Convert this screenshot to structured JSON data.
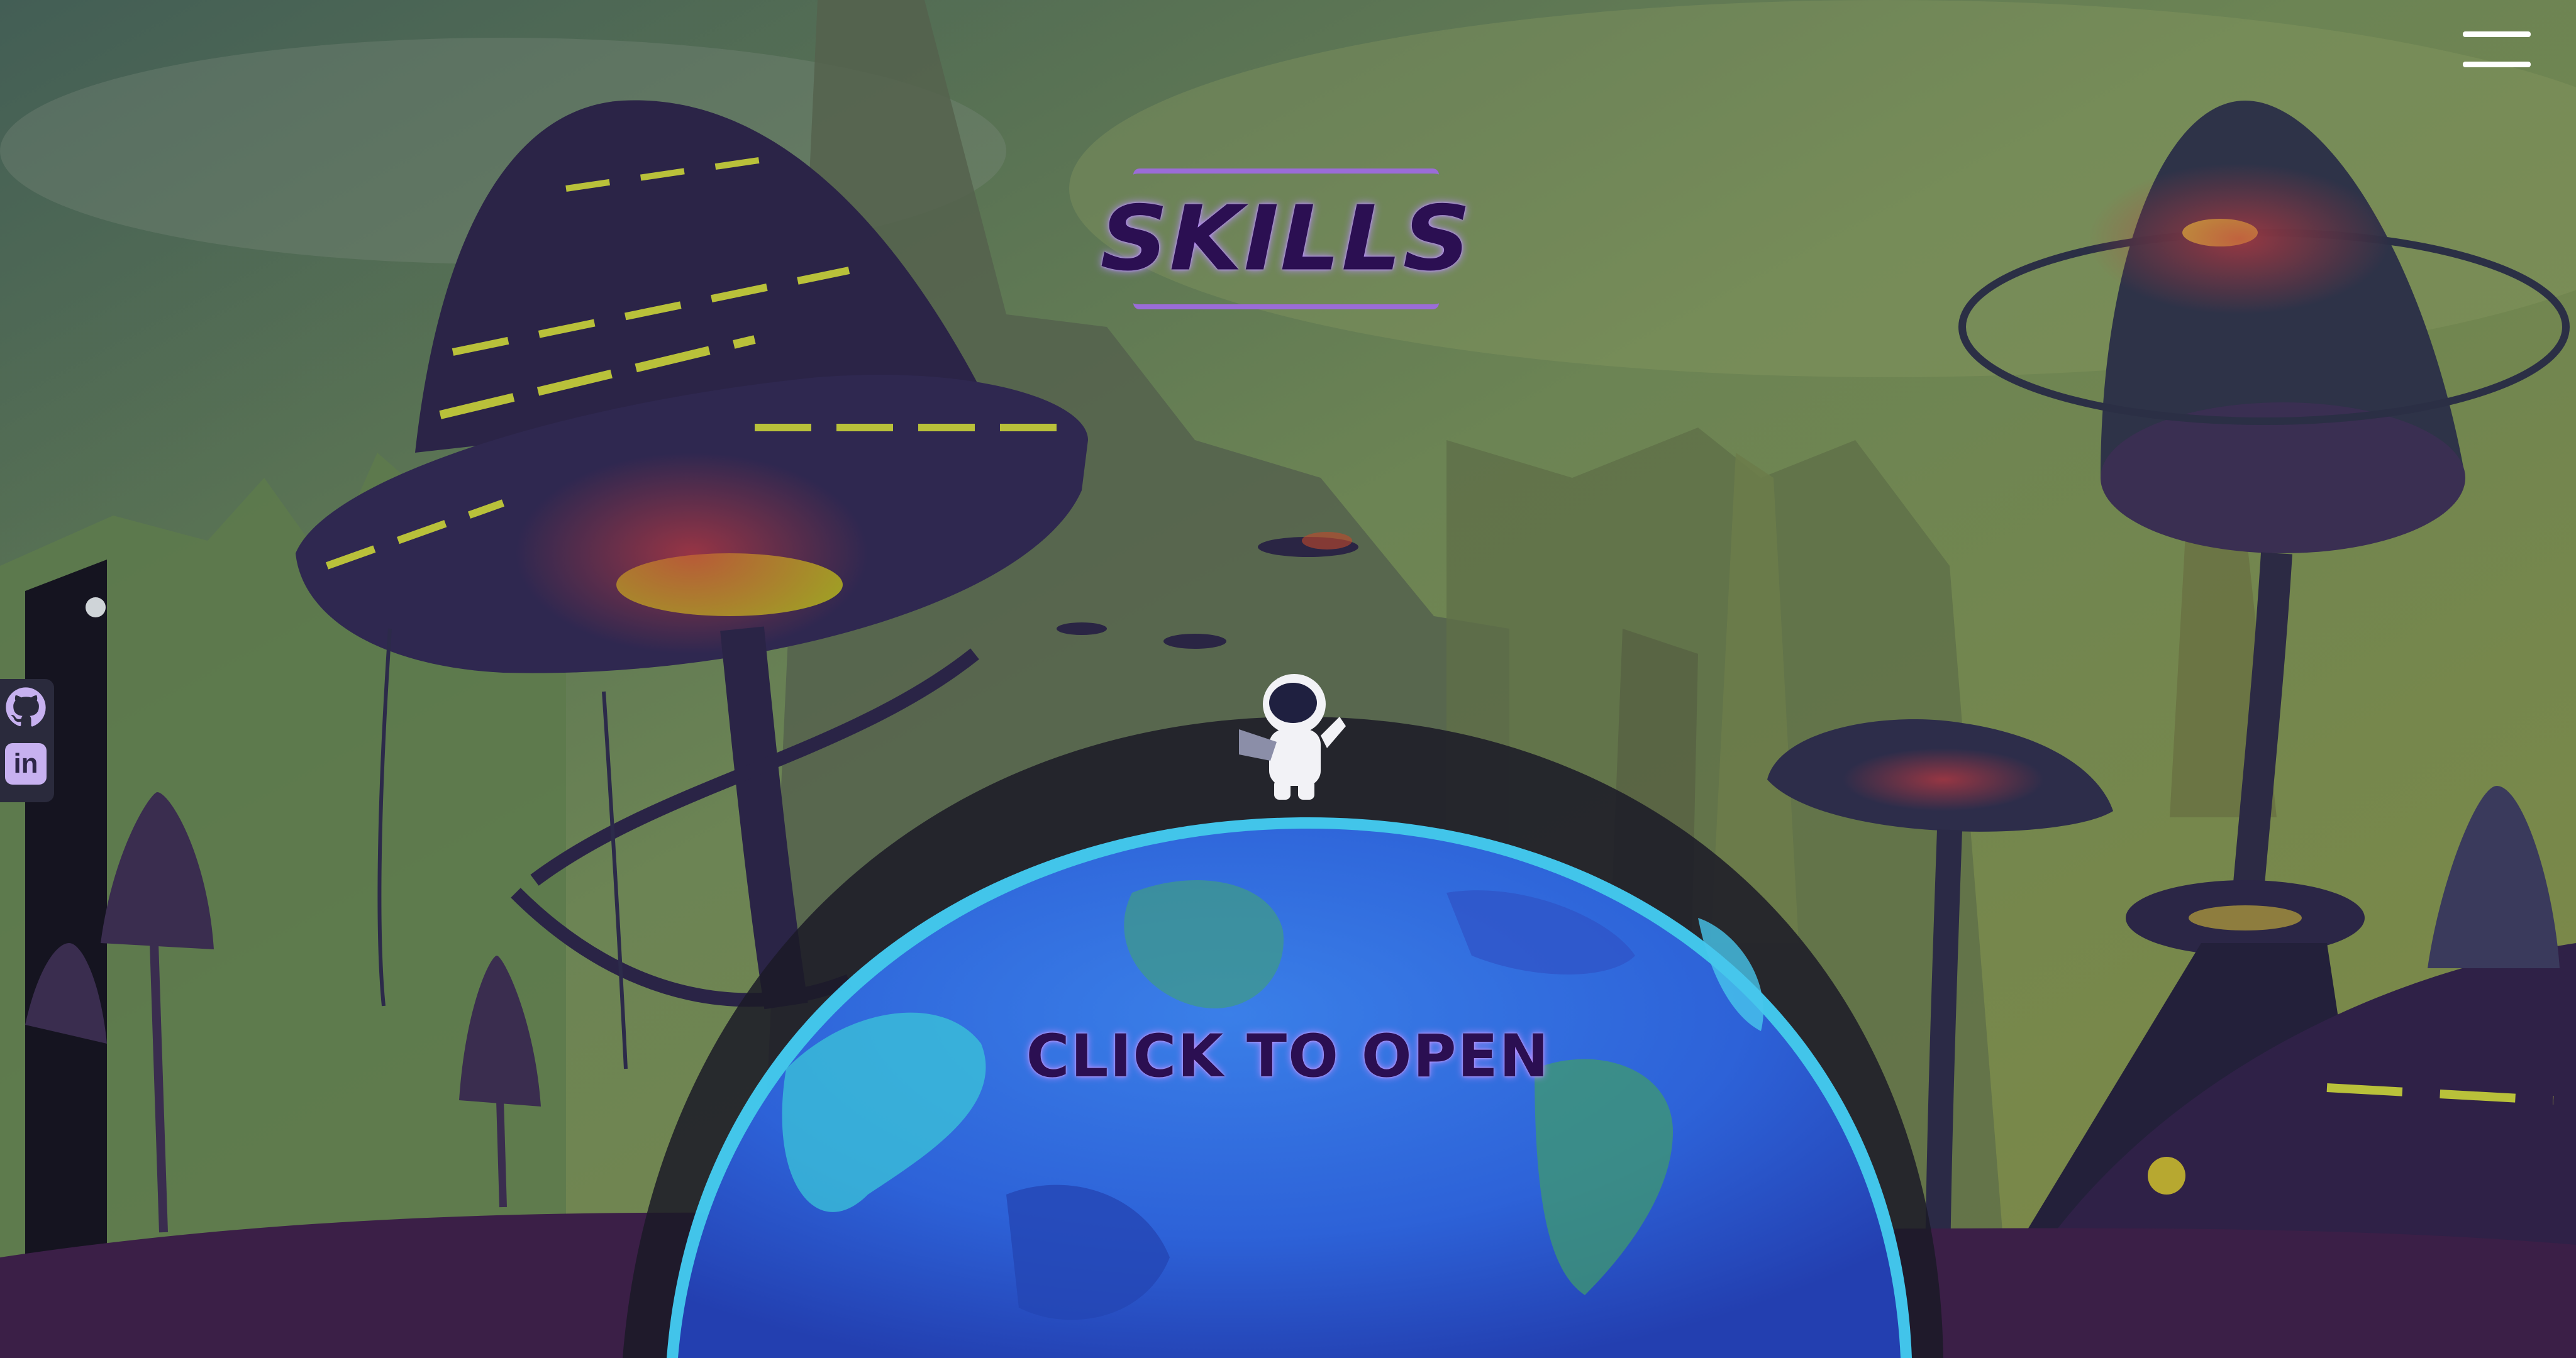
{
  "header": {
    "title": "SKILLS",
    "menu_icon": "hamburger-icon"
  },
  "social": {
    "items": [
      {
        "name": "GitHub",
        "icon": "github-icon"
      },
      {
        "name": "LinkedIn",
        "icon": "linkedin-icon",
        "label": "in"
      }
    ]
  },
  "cta": {
    "label": "CLICK TO OPEN"
  },
  "colors": {
    "title_glow": "#b88cff",
    "title_text": "#2b0f52",
    "planet_blue": "#2f6fe6",
    "rim_glow": "#46d7ff"
  }
}
